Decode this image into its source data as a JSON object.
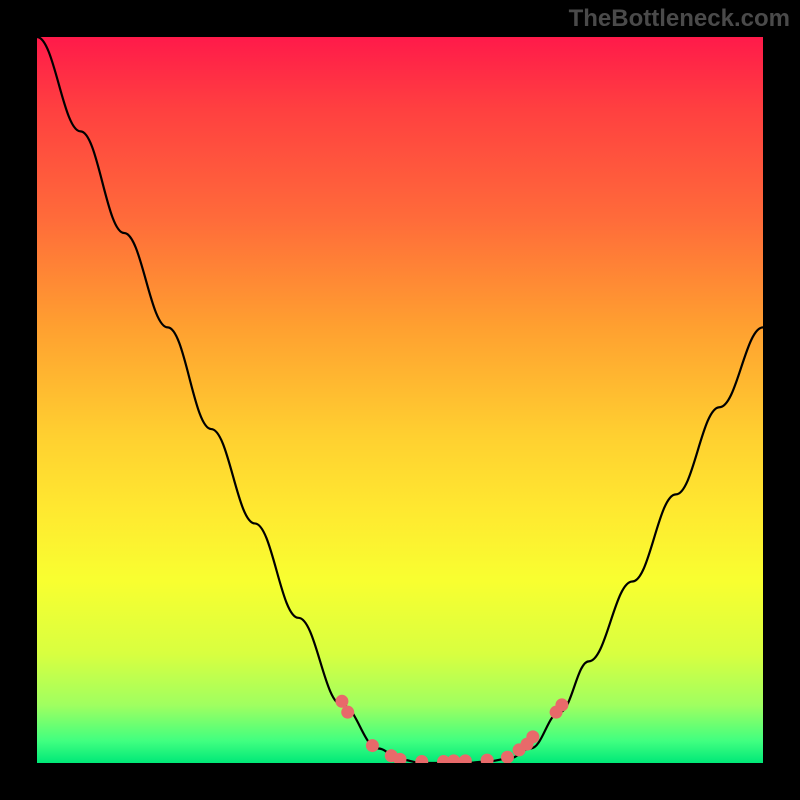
{
  "watermark": "TheBottleneck.com",
  "chart_data": {
    "type": "line",
    "title": "",
    "xlabel": "",
    "ylabel": "",
    "xlim": [
      0,
      100
    ],
    "ylim": [
      0,
      100
    ],
    "grid": false,
    "series": [
      {
        "name": "curve",
        "x": [
          0,
          6,
          12,
          18,
          24,
          30,
          36,
          42,
          47,
          50,
          53,
          56,
          59,
          62,
          65,
          68,
          72,
          76,
          82,
          88,
          94,
          100
        ],
        "y": [
          100,
          87,
          73,
          60,
          46,
          33,
          20,
          8,
          2,
          0.5,
          0,
          0,
          0,
          0.2,
          0.6,
          2,
          7,
          14,
          25,
          37,
          49,
          60
        ]
      },
      {
        "name": "markers",
        "x": [
          42,
          42.8,
          46.2,
          48.8,
          50,
          53,
          56,
          57.4,
          59,
          62,
          64.8,
          66.4,
          67.5,
          68.3,
          71.5,
          72.3
        ],
        "y": [
          8.5,
          7,
          2.4,
          1,
          0.5,
          0.2,
          0.2,
          0.3,
          0.3,
          0.4,
          0.8,
          1.8,
          2.6,
          3.6,
          7,
          8
        ]
      }
    ],
    "gradient_stops": [
      {
        "y": 100,
        "color": "#ff1a4a"
      },
      {
        "y": 65,
        "color": "#ffd030"
      },
      {
        "y": 25,
        "color": "#f8ff30"
      },
      {
        "y": 3,
        "color": "#40ff80"
      },
      {
        "y": 0,
        "color": "#00e878"
      }
    ]
  }
}
